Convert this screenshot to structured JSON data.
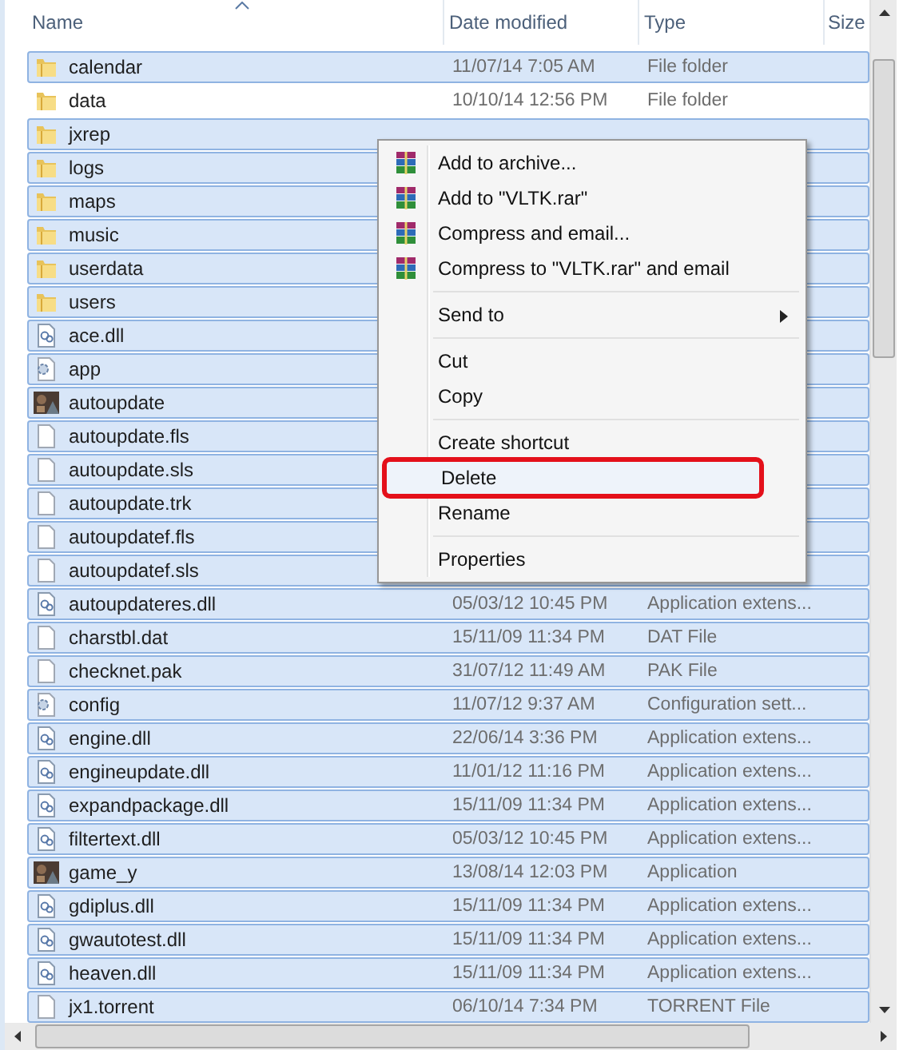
{
  "columns": [
    {
      "label": "Name",
      "sorted": true
    },
    {
      "label": "Date modified",
      "sorted": false
    },
    {
      "label": "Type",
      "sorted": false
    },
    {
      "label": "Size",
      "sorted": false
    }
  ],
  "rows": [
    {
      "name": "calendar",
      "kind": "folder",
      "date": "11/07/14 7:05 AM",
      "type": "File folder",
      "selected": true
    },
    {
      "name": "data",
      "kind": "folder",
      "date": "10/10/14 12:56 PM",
      "type": "File folder",
      "selected": false
    },
    {
      "name": "jxrep",
      "kind": "folder",
      "selected": true
    },
    {
      "name": "logs",
      "kind": "folder",
      "selected": true
    },
    {
      "name": "maps",
      "kind": "folder",
      "selected": true
    },
    {
      "name": "music",
      "kind": "folder",
      "selected": true
    },
    {
      "name": "userdata",
      "kind": "folder",
      "selected": true
    },
    {
      "name": "users",
      "kind": "folder",
      "selected": true
    },
    {
      "name": "ace.dll",
      "kind": "dll",
      "selected": true
    },
    {
      "name": "app",
      "kind": "gear",
      "selected": true
    },
    {
      "name": "autoupdate",
      "kind": "image",
      "selected": true
    },
    {
      "name": "autoupdate.fls",
      "kind": "file",
      "selected": true
    },
    {
      "name": "autoupdate.sls",
      "kind": "file",
      "selected": true
    },
    {
      "name": "autoupdate.trk",
      "kind": "file",
      "selected": true
    },
    {
      "name": "autoupdatef.fls",
      "kind": "file",
      "selected": true
    },
    {
      "name": "autoupdatef.sls",
      "kind": "file",
      "selected": true
    },
    {
      "name": "autoupdateres.dll",
      "kind": "dll",
      "date": "05/03/12 10:45 PM",
      "type": "Application extens...",
      "selected": true
    },
    {
      "name": "charstbl.dat",
      "kind": "file",
      "date": "15/11/09 11:34 PM",
      "type": "DAT File",
      "selected": true
    },
    {
      "name": "checknet.pak",
      "kind": "file",
      "date": "31/07/12 11:49 AM",
      "type": "PAK File",
      "selected": true
    },
    {
      "name": "config",
      "kind": "gear",
      "date": "11/07/12 9:37 AM",
      "type": "Configuration sett...",
      "selected": true
    },
    {
      "name": "engine.dll",
      "kind": "dll",
      "date": "22/06/14 3:36 PM",
      "type": "Application extens...",
      "selected": true
    },
    {
      "name": "engineupdate.dll",
      "kind": "dll",
      "date": "11/01/12 11:16 PM",
      "type": "Application extens...",
      "selected": true
    },
    {
      "name": "expandpackage.dll",
      "kind": "dll",
      "date": "15/11/09 11:34 PM",
      "type": "Application extens...",
      "selected": true
    },
    {
      "name": "filtertext.dll",
      "kind": "dll",
      "date": "05/03/12 10:45 PM",
      "type": "Application extens...",
      "selected": true
    },
    {
      "name": "game_y",
      "kind": "image",
      "date": "13/08/14 12:03 PM",
      "type": "Application",
      "selected": true
    },
    {
      "name": "gdiplus.dll",
      "kind": "dll",
      "date": "15/11/09 11:34 PM",
      "type": "Application extens...",
      "selected": true
    },
    {
      "name": "gwautotest.dll",
      "kind": "dll",
      "date": "15/11/09 11:34 PM",
      "type": "Application extens...",
      "selected": true
    },
    {
      "name": "heaven.dll",
      "kind": "dll",
      "date": "15/11/09 11:34 PM",
      "type": "Application extens...",
      "selected": true
    },
    {
      "name": "jx1.torrent",
      "kind": "file",
      "date": "06/10/14 7:34 PM",
      "type": "TORRENT File",
      "selected": true
    }
  ],
  "context_menu": [
    {
      "kind": "archive",
      "label": "Add to archive...",
      "highlighted": false
    },
    {
      "kind": "archive",
      "label": "Add to \"VLTK.rar\"",
      "highlighted": false
    },
    {
      "kind": "archive",
      "label": "Compress and email...",
      "highlighted": false
    },
    {
      "kind": "archive",
      "label": "Compress to \"VLTK.rar\" and email",
      "highlighted": false
    },
    {
      "kind": "separator"
    },
    {
      "kind": "submenu",
      "label": "Send to",
      "highlighted": false
    },
    {
      "kind": "separator"
    },
    {
      "kind": "item",
      "label": "Cut",
      "highlighted": false
    },
    {
      "kind": "item",
      "label": "Copy",
      "highlighted": false
    },
    {
      "kind": "separator"
    },
    {
      "kind": "item",
      "label": "Create shortcut",
      "highlighted": false
    },
    {
      "kind": "item",
      "label": "Delete",
      "highlighted": true,
      "annotated": true
    },
    {
      "kind": "item",
      "label": "Rename",
      "highlighted": false
    },
    {
      "kind": "separator"
    },
    {
      "kind": "item",
      "label": "Properties",
      "highlighted": false
    }
  ]
}
